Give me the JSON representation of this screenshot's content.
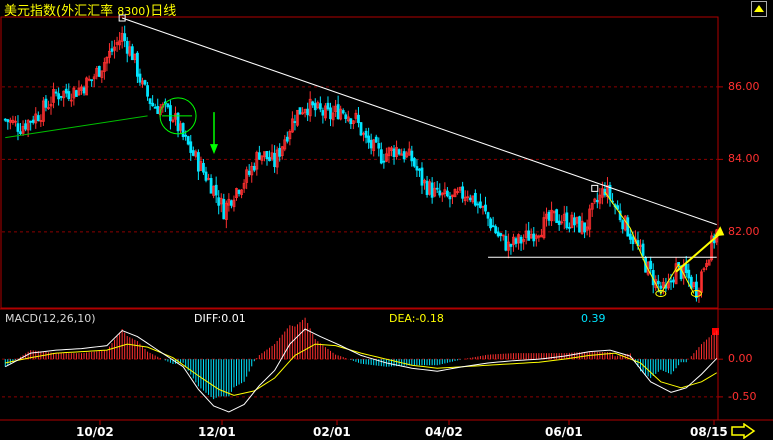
{
  "header": {
    "title": "美元指数",
    "title_bracket": "(外汇汇率",
    "title_code": "8300",
    "title_suffix": ")日线"
  },
  "macd_panel": {
    "title": "MACD(12,26,10)",
    "diff": "DIFF:0.01",
    "dea": "DEA:-0.18",
    "macd": "0.39"
  },
  "colors": {
    "up": "#ff3030",
    "down": "#00e5ff",
    "grid": "#8b0000",
    "axis": "#b00000",
    "diff_line": "#ffffff",
    "dea_line": "#ffff00",
    "trend_line": "#ffffff",
    "support_line": "#00c000"
  },
  "chart_data": [
    {
      "type": "candlestick",
      "title": "美元指数(外汇汇率 8300)日线",
      "y_axis": {
        "ticks": [
          86.0,
          84.0,
          82.0
        ],
        "tick_labels": [
          "86.00",
          "84.00",
          "82.00"
        ],
        "visible_range": [
          79.9,
          87.9
        ]
      },
      "x_axis": {
        "tick_labels": [
          "10/02",
          "12/01",
          "02/01",
          "04/02",
          "06/01",
          "08/15"
        ]
      },
      "close_path": [
        [
          0,
          85.1
        ],
        [
          6,
          84.9
        ],
        [
          14,
          85.3
        ],
        [
          20,
          85.8
        ],
        [
          28,
          85.9
        ],
        [
          34,
          86.2
        ],
        [
          40,
          86.8
        ],
        [
          46,
          87.4
        ],
        [
          50,
          86.9
        ],
        [
          54,
          86.0
        ],
        [
          58,
          85.5
        ],
        [
          62,
          85.4
        ],
        [
          66,
          85.2
        ],
        [
          70,
          84.6
        ],
        [
          76,
          83.9
        ],
        [
          82,
          83.2
        ],
        [
          86,
          82.6
        ],
        [
          90,
          83.1
        ],
        [
          96,
          83.6
        ],
        [
          100,
          84.2
        ],
        [
          106,
          83.9
        ],
        [
          110,
          84.6
        ],
        [
          114,
          85.2
        ],
        [
          118,
          85.5
        ],
        [
          124,
          85.3
        ],
        [
          128,
          85.2
        ],
        [
          132,
          85.4
        ],
        [
          138,
          85.1
        ],
        [
          142,
          84.5
        ],
        [
          148,
          84.1
        ],
        [
          154,
          84.3
        ],
        [
          160,
          84.0
        ],
        [
          164,
          83.4
        ],
        [
          170,
          83.0
        ],
        [
          176,
          82.9
        ],
        [
          182,
          83.1
        ],
        [
          188,
          82.6
        ],
        [
          194,
          81.9
        ],
        [
          198,
          81.6
        ],
        [
          204,
          81.8
        ],
        [
          210,
          82.1
        ],
        [
          216,
          82.4
        ],
        [
          222,
          82.3
        ],
        [
          228,
          82.1
        ],
        [
          232,
          82.7
        ],
        [
          236,
          83.2
        ],
        [
          240,
          82.7
        ],
        [
          244,
          82.2
        ],
        [
          248,
          81.7
        ],
        [
          252,
          81.1
        ],
        [
          256,
          80.6
        ],
        [
          260,
          80.3
        ],
        [
          264,
          81.0
        ],
        [
          268,
          80.8
        ],
        [
          272,
          80.4
        ],
        [
          276,
          81.3
        ],
        [
          280,
          82.0
        ]
      ],
      "annotations": {
        "resistance_line": {
          "from": [
            46,
            87.9
          ],
          "to": [
            280,
            82.2
          ]
        },
        "support_line": {
          "from": [
            0,
            84.6
          ],
          "to": [
            56,
            85.2
          ]
        },
        "neckline": 81.3,
        "pivot_markers": [
          [
            46,
            87.9
          ],
          [
            232,
            83.2
          ]
        ],
        "circle_marker": [
          68,
          85.2
        ],
        "down_arrow_at": 84.2,
        "bottom_markers": [
          [
            258,
            80.3
          ],
          [
            272,
            80.3
          ]
        ],
        "projected_move": {
          "from": [
            264,
            80.9
          ],
          "to": [
            281,
            82.1
          ]
        }
      }
    },
    {
      "type": "bar",
      "title": "MACD(12,26,10)",
      "y_axis": {
        "ticks": [
          0.0,
          -0.5
        ],
        "tick_labels": [
          "0.00",
          "-0.50"
        ],
        "visible_range": [
          -0.78,
          0.44
        ]
      },
      "series": [
        {
          "name": "DIFF",
          "points": [
            [
              0,
              -0.1
            ],
            [
              10,
              0.08
            ],
            [
              20,
              0.12
            ],
            [
              30,
              0.14
            ],
            [
              40,
              0.18
            ],
            [
              46,
              0.38
            ],
            [
              52,
              0.3
            ],
            [
              60,
              0.12
            ],
            [
              70,
              -0.1
            ],
            [
              76,
              -0.4
            ],
            [
              82,
              -0.62
            ],
            [
              88,
              -0.7
            ],
            [
              94,
              -0.6
            ],
            [
              100,
              -0.35
            ],
            [
              106,
              -0.15
            ],
            [
              112,
              0.2
            ],
            [
              118,
              0.4
            ],
            [
              124,
              0.3
            ],
            [
              132,
              0.18
            ],
            [
              140,
              0.05
            ],
            [
              150,
              -0.05
            ],
            [
              160,
              -0.12
            ],
            [
              170,
              -0.16
            ],
            [
              180,
              -0.1
            ],
            [
              190,
              -0.05
            ],
            [
              200,
              -0.02
            ],
            [
              210,
              0.0
            ],
            [
              220,
              0.04
            ],
            [
              230,
              0.1
            ],
            [
              238,
              0.12
            ],
            [
              246,
              0.04
            ],
            [
              254,
              -0.3
            ],
            [
              262,
              -0.44
            ],
            [
              268,
              -0.38
            ],
            [
              274,
              -0.2
            ],
            [
              280,
              0.01
            ]
          ]
        },
        {
          "name": "DEA",
          "points": [
            [
              0,
              -0.05
            ],
            [
              10,
              0.02
            ],
            [
              20,
              0.08
            ],
            [
              30,
              0.1
            ],
            [
              40,
              0.12
            ],
            [
              48,
              0.2
            ],
            [
              56,
              0.16
            ],
            [
              66,
              0.02
            ],
            [
              76,
              -0.22
            ],
            [
              84,
              -0.4
            ],
            [
              90,
              -0.48
            ],
            [
              98,
              -0.42
            ],
            [
              106,
              -0.25
            ],
            [
              114,
              0.05
            ],
            [
              122,
              0.2
            ],
            [
              130,
              0.18
            ],
            [
              140,
              0.08
            ],
            [
              150,
              0.0
            ],
            [
              160,
              -0.08
            ],
            [
              170,
              -0.12
            ],
            [
              180,
              -0.1
            ],
            [
              190,
              -0.08
            ],
            [
              200,
              -0.06
            ],
            [
              210,
              -0.04
            ],
            [
              220,
              0.0
            ],
            [
              230,
              0.05
            ],
            [
              240,
              0.08
            ],
            [
              250,
              -0.05
            ],
            [
              258,
              -0.3
            ],
            [
              266,
              -0.38
            ],
            [
              274,
              -0.3
            ],
            [
              280,
              -0.18
            ]
          ]
        }
      ]
    }
  ]
}
